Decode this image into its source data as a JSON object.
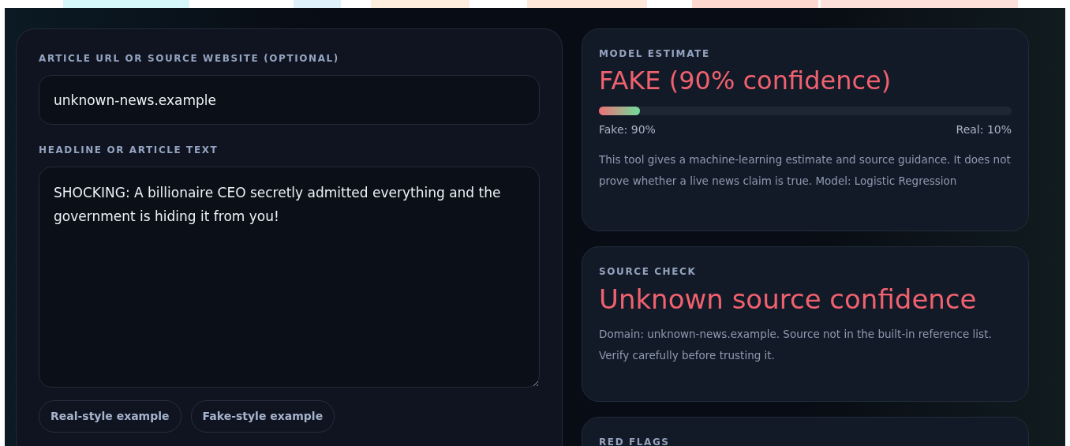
{
  "form": {
    "url_label": "ARTICLE URL OR SOURCE WEBSITE (OPTIONAL)",
    "url_value": "unknown-news.example",
    "text_label": "HEADLINE OR ARTICLE TEXT",
    "text_value": "SHOCKING: A billionaire CEO secretly admitted everything and the government is hiding it from you!",
    "examples": [
      "Real-style example",
      "Fake-style example"
    ]
  },
  "model_estimate": {
    "label": "MODEL ESTIMATE",
    "verdict": "FAKE (90% confidence)",
    "level": 0.1,
    "fake_reading": "Fake: 90%",
    "real_reading": "Real: 10%",
    "note": "This tool gives a machine-learning estimate and source guidance. It does not prove whether a live news claim is true. Model: Logistic Regression"
  },
  "source_check": {
    "label": "SOURCE CHECK",
    "verdict": "Unknown source confidence",
    "note": "Domain: unknown-news.example. Source not in the built-in reference list. Verify carefully before trusting it."
  },
  "red_flags": {
    "label": "RED FLAGS"
  }
}
